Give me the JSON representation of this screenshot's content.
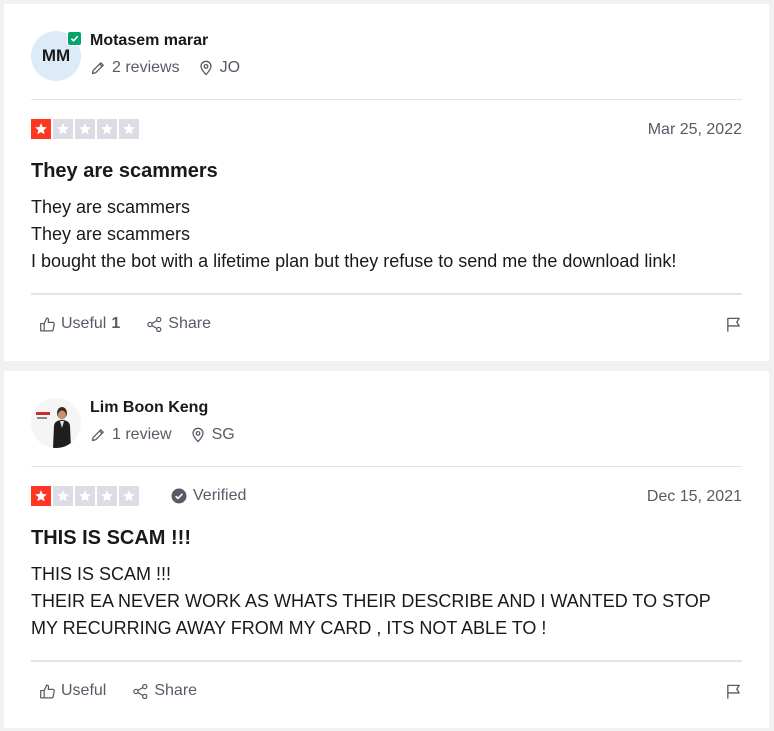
{
  "colors": {
    "star_on": "#ff3722",
    "star_off": "#dcdce6",
    "verified_badge": "#04a56b",
    "muted_text": "#575b66"
  },
  "reviews": [
    {
      "avatar_initials": "MM",
      "reviewer_name": "Motasem marar",
      "review_count": "2 reviews",
      "country": "JO",
      "rating": 1,
      "date": "Mar 25, 2022",
      "title": "They are scammers",
      "body_lines": [
        "They are scammers",
        "They are scammers",
        "I bought the bot with a lifetime plan but they refuse to send me the download link!"
      ],
      "useful_label": "Useful",
      "useful_count": "1",
      "share_label": "Share"
    },
    {
      "reviewer_name": "Lim Boon Keng",
      "review_count": "1 review",
      "country": "SG",
      "rating": 1,
      "verified_label": "Verified",
      "date": "Dec 15, 2021",
      "title": "THIS IS SCAM !!!",
      "body_lines": [
        "THIS IS SCAM !!!",
        "THEIR EA NEVER WORK AS WHATS THEIR DESCRIBE AND I WANTED TO STOP",
        "MY RECURRING AWAY FROM MY CARD , ITS NOT ABLE TO !"
      ],
      "useful_label": "Useful",
      "share_label": "Share"
    }
  ]
}
